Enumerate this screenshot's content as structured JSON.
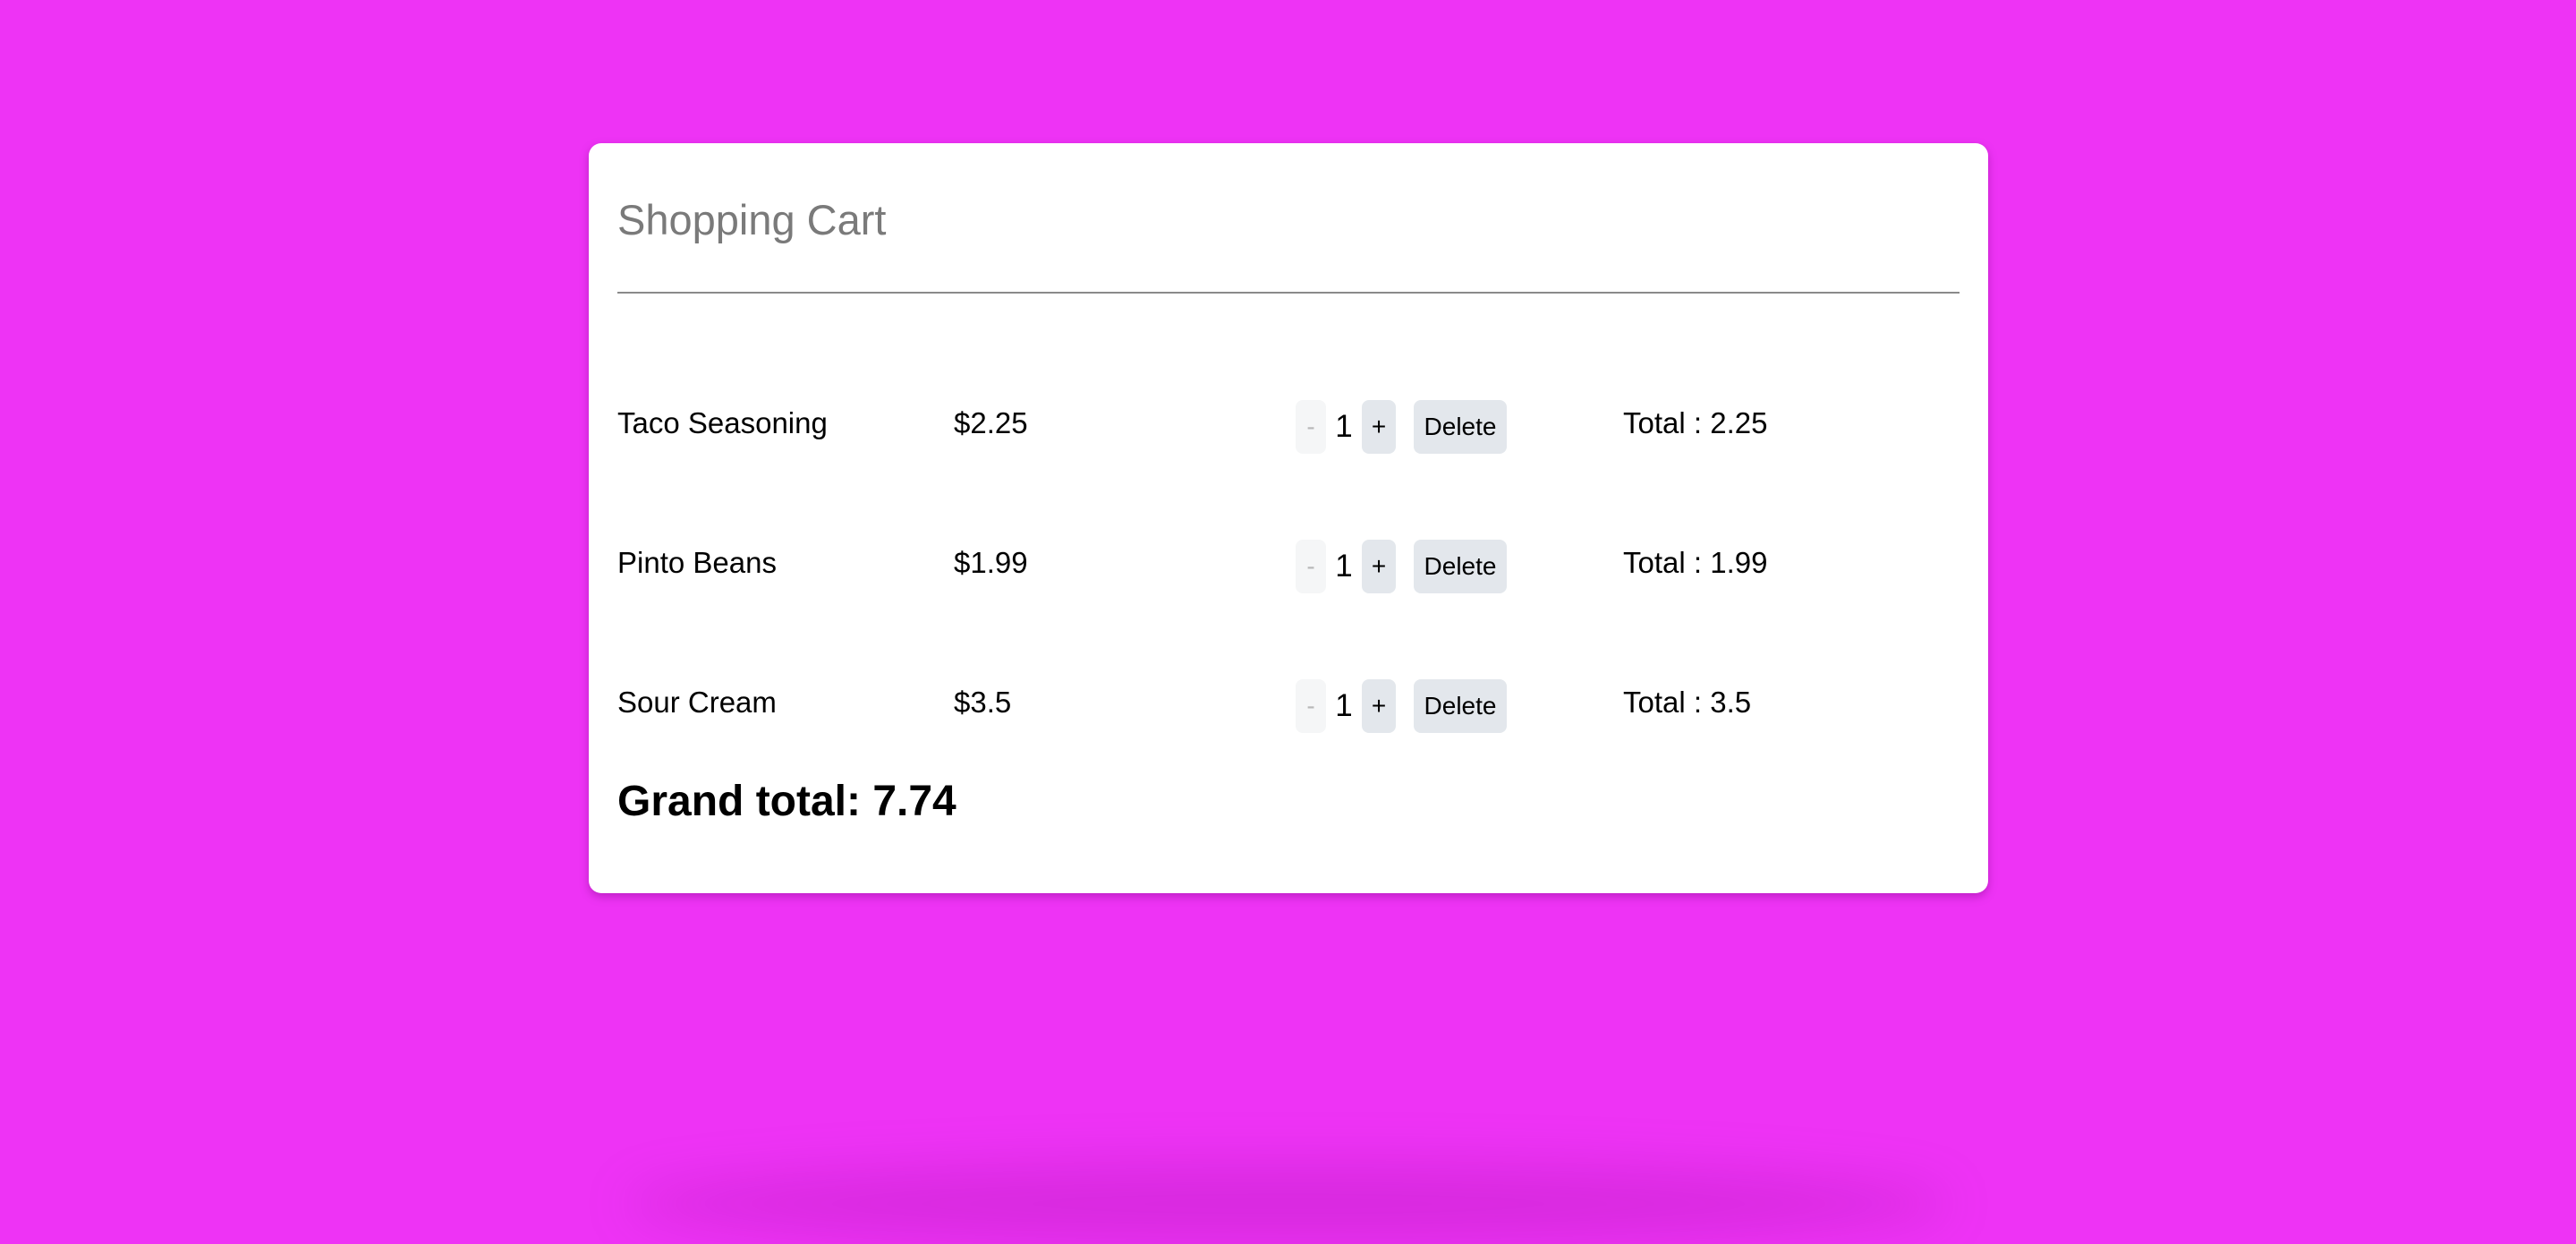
{
  "cart": {
    "title": "Shopping Cart",
    "items": [
      {
        "name": "Taco Seasoning",
        "price": "$2.25",
        "quantity": "1",
        "minus_label": "-",
        "plus_label": "+",
        "delete_label": "Delete",
        "total": "Total : 2.25"
      },
      {
        "name": "Pinto Beans",
        "price": "$1.99",
        "quantity": "1",
        "minus_label": "-",
        "plus_label": "+",
        "delete_label": "Delete",
        "total": "Total : 1.99"
      },
      {
        "name": "Sour Cream",
        "price": "$3.5",
        "quantity": "1",
        "minus_label": "-",
        "plus_label": "+",
        "delete_label": "Delete",
        "total": "Total : 3.5"
      }
    ],
    "grand_total": "Grand total: 7.74"
  },
  "colors": {
    "page_background": "#ee33f5",
    "card_background": "#ffffff",
    "title_text": "#7a7a7a",
    "button_background": "#e3e7ec",
    "disabled_button_background": "#f5f6f7"
  }
}
